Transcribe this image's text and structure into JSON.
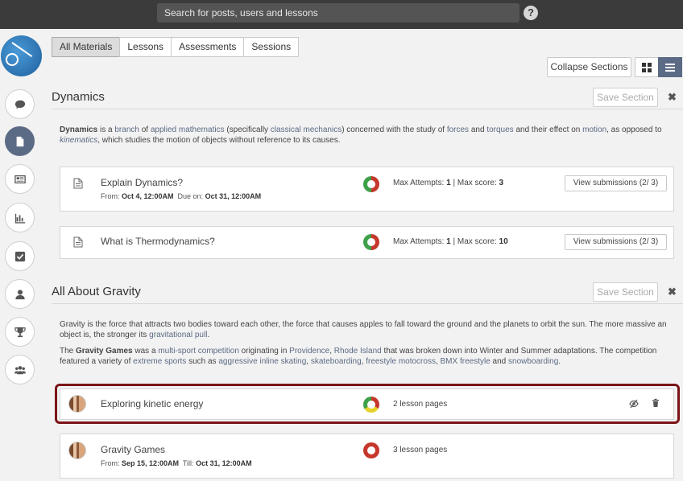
{
  "search": {
    "placeholder": "Search for posts, users and lessons"
  },
  "help": {
    "label": "?"
  },
  "tabs": [
    {
      "label": "All Materials",
      "active": true
    },
    {
      "label": "Lessons",
      "active": false
    },
    {
      "label": "Assessments",
      "active": false
    },
    {
      "label": "Sessions",
      "active": false
    }
  ],
  "toolbar": {
    "collapse_label": "Collapse Sections"
  },
  "sidebar": {
    "items": [
      {
        "icon": "chat-icon",
        "active": false
      },
      {
        "icon": "folder-icon",
        "active": true
      },
      {
        "icon": "newspaper-icon",
        "active": false
      },
      {
        "icon": "bar-chart-icon",
        "active": false
      },
      {
        "icon": "checkbox-icon",
        "active": false
      },
      {
        "icon": "user-icon",
        "active": false
      },
      {
        "icon": "trophy-icon",
        "active": false
      },
      {
        "icon": "users-icon",
        "active": false
      }
    ]
  },
  "sections": [
    {
      "title": "Dynamics",
      "save_label": "Save Section",
      "close": "✖",
      "desc": {
        "p1": "Dynamics",
        "p2": " is a ",
        "p3": "branch",
        "p4": " of ",
        "p5": "applied mathematics",
        "p6": " (specifically ",
        "p7": "classical mechanics",
        "p8": ") concerned with the study of ",
        "p9": "forces",
        "p10": " and ",
        "p11": "torques",
        "p12": " and their effect on ",
        "p13": "motion",
        "p14": ", as opposed to ",
        "p15": "kinematics",
        "p16": ", which studies the motion of objects without reference to its causes."
      },
      "items": [
        {
          "title": "Explain Dynamics?",
          "from_label": "From: ",
          "from": "Oct 4, 12:00AM",
          "due_label": "  Due on: ",
          "due": "Oct 31, 12:00AM",
          "attempts_label": "Max Attempts: ",
          "attempts": "1",
          "sep": " | ",
          "score_label": "Max score: ",
          "score": "3",
          "button": "View submissions (2/ 3)"
        },
        {
          "title": "What is Thermodynamics?",
          "attempts_label": "Max Attempts: ",
          "attempts": "1",
          "sep": " | ",
          "score_label": "Max score: ",
          "score": "10",
          "button": "View submissions (2/ 3)"
        }
      ]
    },
    {
      "title": "All About Gravity",
      "save_label": "Save Section",
      "close": "✖",
      "desc": {
        "a1": "Gravity is the force that attracts two bodies toward each other, the force that causes apples to fall toward the ground and the planets to orbit the sun. The more massive an object is, the stronger its ",
        "a2": "gravitational pull",
        "a3": ".",
        "b1": "The ",
        "b2": "Gravity Games",
        "b3": " was a ",
        "b4": "multi-sport competition",
        "b5": " originating in ",
        "b6": "Providence",
        "b7": ", ",
        "b8": "Rhode Island",
        "b9": " that was broken down into Winter and Summer adaptations. The competition featured a variety of ",
        "b10": "extreme sports",
        "b11": " such as ",
        "b12": "aggressive inline skating",
        "b13": ", ",
        "b14": "skateboarding",
        "b15": ", ",
        "b16": "freestyle motocross",
        "b17": ", ",
        "b18": "BMX freestyle",
        "b19": " and ",
        "b20": "snowboarding",
        "b21": "."
      },
      "items": [
        {
          "title": "Exploring kinetic energy",
          "pages": "2 lesson pages"
        },
        {
          "title": "Gravity Games",
          "pages": "3 lesson pages",
          "from_label": "From: ",
          "from": "Sep 15, 12:00AM",
          "till_label": "  Till: ",
          "till": "Oct 31, 12:00AM"
        }
      ]
    }
  ]
}
